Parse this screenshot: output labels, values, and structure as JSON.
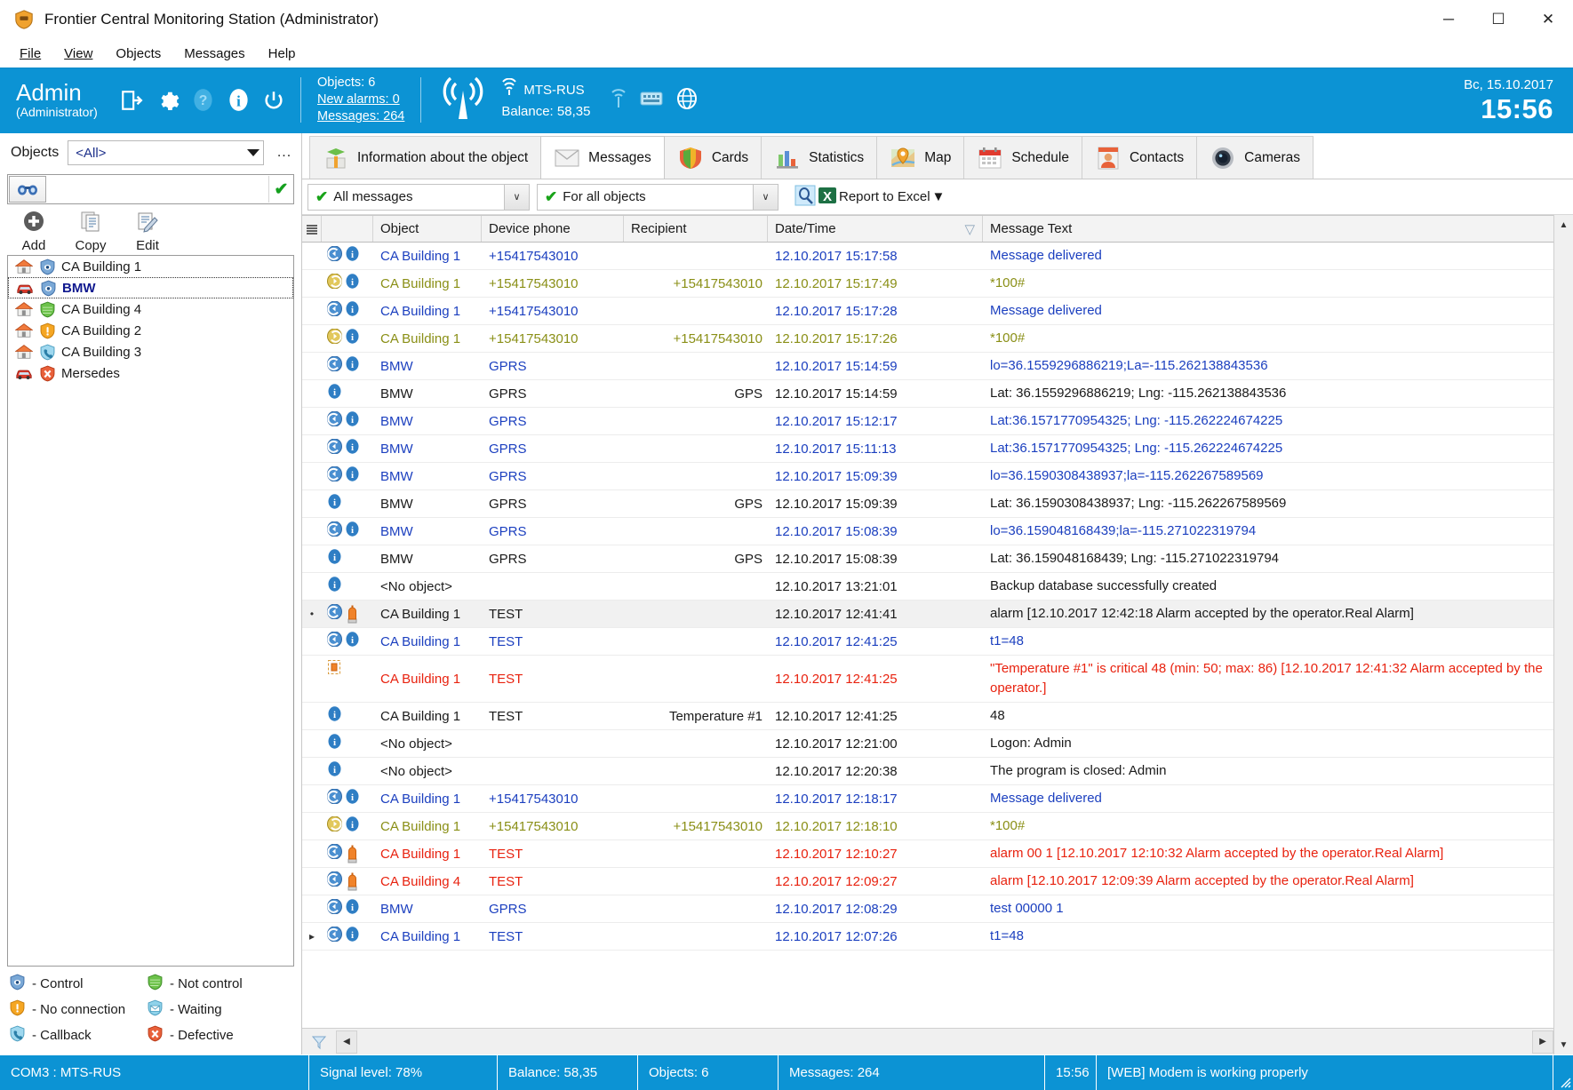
{
  "window": {
    "title": "Frontier Central Monitoring Station (Administrator)",
    "minimize": "─",
    "maximize": "☐",
    "close": "✕"
  },
  "menu": [
    "File",
    "View",
    "Objects",
    "Messages",
    "Help"
  ],
  "toolbar": {
    "user_name": "Admin",
    "user_role": "(Administrator)",
    "icons": [
      "logout-icon",
      "settings-icon",
      "help-icon",
      "info-icon",
      "power-icon"
    ],
    "stats": {
      "objects": "Objects:  6",
      "new_alarms": "New alarms: 0",
      "messages": "Messages:  264"
    },
    "operator": "MTS-RUS",
    "balance": "Balance:  58,35",
    "small_icons": [
      "signal-icon",
      "keyboard-icon",
      "web-icon"
    ],
    "date": "Вс, 15.10.2017",
    "time": "15:56"
  },
  "sidebar": {
    "label": "Objects",
    "filter_value": "<All>",
    "ellipsis": "...",
    "search_value": "",
    "search_placeholder": "",
    "ok": "✔",
    "actions": [
      {
        "label": "Add",
        "icon": "add-icon"
      },
      {
        "label": "Copy",
        "icon": "copy-icon"
      },
      {
        "label": "Edit",
        "icon": "edit-icon"
      }
    ],
    "objects": [
      {
        "name": "CA Building 1",
        "type": "home",
        "status": "control",
        "selected": false
      },
      {
        "name": "BMW",
        "type": "car",
        "status": "control",
        "selected": true
      },
      {
        "name": "CA Building 4",
        "type": "home",
        "status": "not-control",
        "selected": false
      },
      {
        "name": "CA Building 2",
        "type": "home",
        "status": "no-connection",
        "selected": false
      },
      {
        "name": "CA Building 3",
        "type": "home",
        "status": "callback",
        "selected": false
      },
      {
        "name": "Mersedes",
        "type": "car",
        "status": "defective",
        "selected": false
      }
    ],
    "legend": [
      {
        "label": "- Control",
        "status": "control"
      },
      {
        "label": "- Not control",
        "status": "not-control"
      },
      {
        "label": "- No connection",
        "status": "no-connection"
      },
      {
        "label": "- Waiting",
        "status": "waiting"
      },
      {
        "label": "- Callback",
        "status": "callback"
      },
      {
        "label": "- Defective",
        "status": "defective"
      }
    ]
  },
  "tabs": [
    {
      "label": "Information about the object",
      "icon": "object-info-icon",
      "active": false
    },
    {
      "label": "Messages",
      "icon": "envelope-icon",
      "active": true
    },
    {
      "label": "Cards",
      "icon": "cards-shield-icon",
      "active": false
    },
    {
      "label": "Statistics",
      "icon": "bar-chart-icon",
      "active": false
    },
    {
      "label": "Map",
      "icon": "map-pin-icon",
      "active": false
    },
    {
      "label": "Schedule",
      "icon": "calendar-icon",
      "active": false
    },
    {
      "label": "Contacts",
      "icon": "contact-card-icon",
      "active": false
    },
    {
      "label": "Cameras",
      "icon": "camera-icon",
      "active": false
    }
  ],
  "filters": {
    "messages_filter": "All messages",
    "objects_filter": "For all objects",
    "report_button": "Report to Excel",
    "caret": "∨"
  },
  "table": {
    "columns": [
      "Object",
      "Device phone",
      "Recipient",
      "Date/Time",
      "Message Text"
    ],
    "sort_column": "Date/Time",
    "sort_indicator": "▽",
    "rows": [
      {
        "indicator": "",
        "icons": [
          "incoming",
          "info"
        ],
        "object": "CA Building 1",
        "phone": "+15417543010",
        "recipient": "",
        "datetime": "12.10.2017 15:17:58",
        "text": "Message delivered",
        "color": "blue",
        "selected": false
      },
      {
        "indicator": "",
        "icons": [
          "outgoing",
          "info"
        ],
        "object": "CA Building 1",
        "phone": "+15417543010",
        "recipient": "+15417543010",
        "datetime": "12.10.2017 15:17:49",
        "text": "*100#",
        "color": "olive",
        "selected": false
      },
      {
        "indicator": "",
        "icons": [
          "incoming",
          "info"
        ],
        "object": "CA Building 1",
        "phone": "+15417543010",
        "recipient": "",
        "datetime": "12.10.2017 15:17:28",
        "text": "Message delivered",
        "color": "blue",
        "selected": false
      },
      {
        "indicator": "",
        "icons": [
          "outgoing",
          "info"
        ],
        "object": "CA Building 1",
        "phone": "+15417543010",
        "recipient": "+15417543010",
        "datetime": "12.10.2017 15:17:26",
        "text": "*100#",
        "color": "olive",
        "selected": false
      },
      {
        "indicator": "",
        "icons": [
          "incoming",
          "info"
        ],
        "object": "BMW",
        "phone": "GPRS",
        "recipient": "",
        "datetime": "12.10.2017 15:14:59",
        "text": "lo=36.1559296886219;La=-115.262138843536",
        "color": "blue",
        "selected": false
      },
      {
        "indicator": "",
        "icons": [
          "info"
        ],
        "object": "BMW",
        "phone": "GPRS",
        "recipient": "GPS",
        "datetime": "12.10.2017 15:14:59",
        "text": "Lat: 36.1559296886219; Lng: -115.262138843536",
        "color": "black",
        "selected": false
      },
      {
        "indicator": "",
        "icons": [
          "incoming",
          "info"
        ],
        "object": "BMW",
        "phone": "GPRS",
        "recipient": "",
        "datetime": "12.10.2017 15:12:17",
        "text": "Lat:36.1571770954325; Lng: -115.262224674225",
        "color": "blue",
        "selected": false
      },
      {
        "indicator": "",
        "icons": [
          "incoming",
          "info"
        ],
        "object": "BMW",
        "phone": "GPRS",
        "recipient": "",
        "datetime": "12.10.2017 15:11:13",
        "text": "Lat:36.1571770954325; Lng: -115.262224674225",
        "color": "blue",
        "selected": false
      },
      {
        "indicator": "",
        "icons": [
          "incoming",
          "info"
        ],
        "object": "BMW",
        "phone": "GPRS",
        "recipient": "",
        "datetime": "12.10.2017 15:09:39",
        "text": "lo=36.1590308438937;la=-115.262267589569",
        "color": "blue",
        "selected": false
      },
      {
        "indicator": "",
        "icons": [
          "info"
        ],
        "object": "BMW",
        "phone": "GPRS",
        "recipient": "GPS",
        "datetime": "12.10.2017 15:09:39",
        "text": "Lat: 36.1590308438937; Lng: -115.262267589569",
        "color": "black",
        "selected": false
      },
      {
        "indicator": "",
        "icons": [
          "incoming",
          "info"
        ],
        "object": "BMW",
        "phone": "GPRS",
        "recipient": "",
        "datetime": "12.10.2017 15:08:39",
        "text": "lo=36.159048168439;la=-115.271022319794",
        "color": "blue",
        "selected": false
      },
      {
        "indicator": "",
        "icons": [
          "info"
        ],
        "object": "BMW",
        "phone": "GPRS",
        "recipient": "GPS",
        "datetime": "12.10.2017 15:08:39",
        "text": "Lat: 36.159048168439; Lng: -115.271022319794",
        "color": "black",
        "selected": false
      },
      {
        "indicator": "",
        "icons": [
          "info"
        ],
        "object": "<No object>",
        "phone": "",
        "recipient": "",
        "datetime": "12.10.2017 13:21:01",
        "text": "Backup database successfully created",
        "color": "black",
        "selected": false
      },
      {
        "indicator": "•",
        "icons": [
          "incoming",
          "alarm"
        ],
        "object": "CA Building 1",
        "phone": "TEST",
        "recipient": "",
        "datetime": "12.10.2017 12:41:41",
        "text": "alarm [12.10.2017 12:42:18 Alarm accepted by the operator.Real Alarm]",
        "color": "black",
        "selected": true
      },
      {
        "indicator": "",
        "icons": [
          "incoming",
          "info"
        ],
        "object": "CA Building 1",
        "phone": "TEST",
        "recipient": "",
        "datetime": "12.10.2017 12:41:25",
        "text": "t1=48",
        "color": "blue",
        "selected": false
      },
      {
        "indicator": "",
        "icons": [
          "alarm-small"
        ],
        "object": "CA Building 1",
        "phone": "TEST",
        "recipient": "",
        "datetime": "12.10.2017 12:41:25",
        "text": "\"Temperature #1\" is critical 48 (min: 50; max: 86) [12.10.2017 12:41:32 Alarm accepted by the operator.]",
        "color": "red",
        "selected": false
      },
      {
        "indicator": "",
        "icons": [
          "info"
        ],
        "object": "CA Building 1",
        "phone": "TEST",
        "recipient": "Temperature #1",
        "datetime": "12.10.2017 12:41:25",
        "text": "48",
        "color": "black",
        "selected": false
      },
      {
        "indicator": "",
        "icons": [
          "info"
        ],
        "object": "<No object>",
        "phone": "",
        "recipient": "",
        "datetime": "12.10.2017 12:21:00",
        "text": "Logon: Admin",
        "color": "black",
        "selected": false
      },
      {
        "indicator": "",
        "icons": [
          "info"
        ],
        "object": "<No object>",
        "phone": "",
        "recipient": "",
        "datetime": "12.10.2017 12:20:38",
        "text": "The program is closed: Admin",
        "color": "black",
        "selected": false
      },
      {
        "indicator": "",
        "icons": [
          "incoming",
          "info"
        ],
        "object": "CA Building 1",
        "phone": "+15417543010",
        "recipient": "",
        "datetime": "12.10.2017 12:18:17",
        "text": "Message delivered",
        "color": "blue",
        "selected": false
      },
      {
        "indicator": "",
        "icons": [
          "outgoing",
          "info"
        ],
        "object": "CA Building 1",
        "phone": "+15417543010",
        "recipient": "+15417543010",
        "datetime": "12.10.2017 12:18:10",
        "text": "*100#",
        "color": "olive",
        "selected": false
      },
      {
        "indicator": "",
        "icons": [
          "incoming",
          "alarm"
        ],
        "object": "CA Building 1",
        "phone": "TEST",
        "recipient": "",
        "datetime": "12.10.2017 12:10:27",
        "text": "alarm 00 1 [12.10.2017 12:10:32 Alarm accepted by the operator.Real Alarm]",
        "color": "red",
        "selected": false
      },
      {
        "indicator": "",
        "icons": [
          "incoming",
          "alarm"
        ],
        "object": "CA Building 4",
        "phone": "TEST",
        "recipient": "",
        "datetime": "12.10.2017 12:09:27",
        "text": "alarm [12.10.2017 12:09:39 Alarm accepted by the operator.Real Alarm]",
        "color": "red",
        "selected": false
      },
      {
        "indicator": "",
        "icons": [
          "incoming",
          "info"
        ],
        "object": "BMW",
        "phone": "GPRS",
        "recipient": "",
        "datetime": "12.10.2017 12:08:29",
        "text": "test 00000 1",
        "color": "blue",
        "selected": false
      },
      {
        "indicator": "▸",
        "icons": [
          "incoming",
          "info"
        ],
        "object": "CA Building 1",
        "phone": "TEST",
        "recipient": "",
        "datetime": "12.10.2017 12:07:26",
        "text": "t1=48",
        "color": "blue",
        "selected": false
      }
    ]
  },
  "statusbar": [
    "COM3 :  MTS-RUS",
    "Signal level: 78%",
    "Balance:  58,35",
    "Objects:  6",
    "Messages:  264",
    "15:56",
    "[WEB] Modem is working properly"
  ],
  "colors": {
    "accent": "#0c93d4",
    "link": "#1b3fbf",
    "alarm": "#e8220f",
    "outgoing": "#8a8f16"
  }
}
